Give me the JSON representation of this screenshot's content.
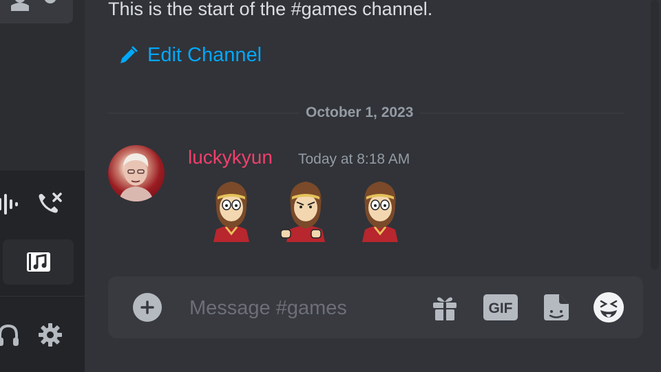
{
  "channel": {
    "intro_text": "This is the start of the #games channel.",
    "edit_label": "Edit Channel",
    "icon": "pencil-icon"
  },
  "divider": {
    "date": "October 1, 2023"
  },
  "message": {
    "author": "luckykyun",
    "author_color": "#f23f6b",
    "timestamp": "Today at 8:18 AM",
    "stickers": [
      "monkey-king-sticker",
      "monkey-king-fists-sticker",
      "monkey-king-sticker"
    ]
  },
  "composer": {
    "placeholder": "Message #games",
    "gif_label": "GIF",
    "icons": [
      "plus-icon",
      "gift-icon",
      "gif-icon",
      "sticker-icon",
      "emoji-icon"
    ]
  },
  "sidebar": {
    "icons": [
      "user-icon",
      "gear-icon",
      "soundboard-icon",
      "disconnect-call-icon",
      "music-activity-icon",
      "headphones-icon",
      "settings-gear-icon"
    ]
  },
  "colors": {
    "accent": "#00a8fc",
    "background": "#313338",
    "sidebar": "#2b2d31"
  }
}
